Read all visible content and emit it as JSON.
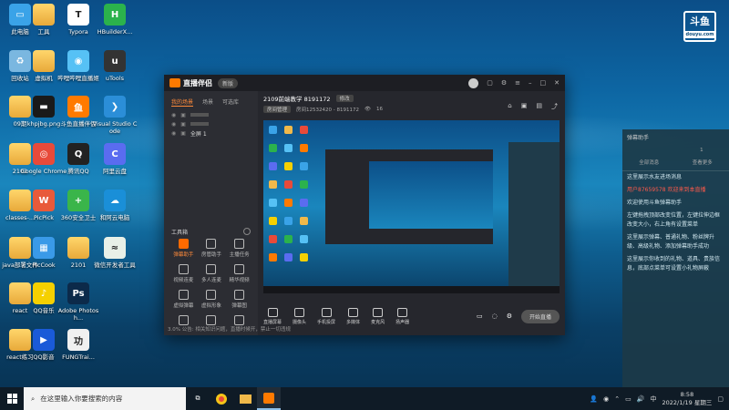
{
  "desktop_icons": [
    {
      "label": "此电脑",
      "color": "#3aa3e8",
      "glyph": "▭"
    },
    {
      "label": "工具",
      "color": "#f0b94a",
      "glyph": ""
    },
    {
      "label": "Typora",
      "color": "#ffffff",
      "glyph": "T"
    },
    {
      "label": "HBuilderX...",
      "color": "#2bb24c",
      "glyph": "H"
    },
    {
      "label": "回收站",
      "color": "#7ab7e0",
      "glyph": "♻"
    },
    {
      "label": "虚拟机",
      "color": "#f0b94a",
      "glyph": ""
    },
    {
      "label": "哔哩哔哩直播姬",
      "color": "#56c1f5",
      "glyph": "◉"
    },
    {
      "label": "uTools",
      "color": "#333333",
      "glyph": "u"
    },
    {
      "label": "09期",
      "color": "#f0b94a",
      "glyph": ""
    },
    {
      "label": "khpjbg.png",
      "color": "#1a1a1a",
      "glyph": "▬"
    },
    {
      "label": "斗鱼直播伴侣",
      "color": "#ff7a00",
      "glyph": "鱼"
    },
    {
      "label": "Visual Studio Code",
      "color": "#2b8ed8",
      "glyph": "❯"
    },
    {
      "label": "2101",
      "color": "#f0b94a",
      "glyph": ""
    },
    {
      "label": "Google Chrome",
      "color": "#e84a3a",
      "glyph": "◎"
    },
    {
      "label": "腾讯QQ",
      "color": "#222222",
      "glyph": "Q"
    },
    {
      "label": "阿里云盘",
      "color": "#5a6cf0",
      "glyph": "C"
    },
    {
      "label": "classes-...",
      "color": "#f0b94a",
      "glyph": ""
    },
    {
      "label": "PicPick",
      "color": "#e85a3a",
      "glyph": "W"
    },
    {
      "label": "360安全卫士",
      "color": "#3ab54a",
      "glyph": "+"
    },
    {
      "label": "和阿云电脑",
      "color": "#1a8fd8",
      "glyph": "☁"
    },
    {
      "label": "java部署文件",
      "color": "#f0b94a",
      "glyph": ""
    },
    {
      "label": "PicCook",
      "color": "#3a9ae8",
      "glyph": "▦"
    },
    {
      "label": "2101",
      "color": "#f0b94a",
      "glyph": ""
    },
    {
      "label": "微信开发者工具",
      "color": "#e8f0e8",
      "glyph": "≈"
    },
    {
      "label": "react",
      "color": "#f0b94a",
      "glyph": ""
    },
    {
      "label": "QQ音乐",
      "color": "#f5d000",
      "glyph": "♪"
    },
    {
      "label": "Adobe Photosh...",
      "color": "#0c2a4a",
      "glyph": "Ps"
    },
    {
      "label": "",
      "color": "#00000000",
      "glyph": ""
    },
    {
      "label": "react练习",
      "color": "#f0b94a",
      "glyph": ""
    },
    {
      "label": "QQ影音",
      "color": "#1a5ad8",
      "glyph": "▶"
    },
    {
      "label": "FUNGTrai...",
      "color": "#f0f0f0",
      "glyph": "功"
    }
  ],
  "window": {
    "app_name": "直播伴侣",
    "version_badge": "新版",
    "left_tabs": [
      "我的场景",
      "场景",
      "可选库"
    ],
    "active_tab_index": 0,
    "scene_rows": [
      {
        "label": "",
        "muted": true
      },
      {
        "label": "",
        "muted": true
      },
      {
        "label": "全屏 1",
        "muted": false
      }
    ],
    "tools_header": "工具箱",
    "tools": [
      {
        "label": "弹幕助手",
        "highlight": true
      },
      {
        "label": "房管助手",
        "highlight": false
      },
      {
        "label": "主播任务",
        "highlight": false
      },
      {
        "label": "视频连麦",
        "highlight": false
      },
      {
        "label": "多人连麦",
        "highlight": false
      },
      {
        "label": "精华视频",
        "highlight": false
      },
      {
        "label": "虚拟弹幕",
        "highlight": false
      },
      {
        "label": "虚拟形象",
        "highlight": false
      },
      {
        "label": "弹幕图",
        "highlight": false
      },
      {
        "label": "",
        "highlight": false
      },
      {
        "label": "",
        "highlight": false
      },
      {
        "label": "",
        "highlight": false
      }
    ],
    "room_title": "2109前端教学 8191172",
    "room_edit": "修改",
    "room_sub_btn": "房间管理",
    "room_id_text": "房间12532420 - 8191172",
    "room_count": "16",
    "controls": [
      {
        "label": "直播屏幕"
      },
      {
        "label": "摄像头"
      },
      {
        "label": "手机投屏"
      },
      {
        "label": "多媒体"
      },
      {
        "label": "麦克风"
      },
      {
        "label": "扬声器"
      }
    ],
    "start_button": "开始直播",
    "status_text": "3.0% 公告: 相关知识问题，直播时候开，禁止一切违规"
  },
  "side_panel": {
    "title": "弹幕助手",
    "tabs_row1": [
      "",
      "1"
    ],
    "tabs_row2": [
      "全部消息",
      "查看更多"
    ],
    "messages": [
      {
        "text": "这里展示水友进场消息",
        "red": false
      },
      {
        "text": "用户87659578 欢迎来到本直播",
        "red": true
      },
      {
        "text": "欢迎使用斗鱼弹幕助手",
        "red": false
      },
      {
        "text": "左键拖拽顶部改变位置，左键拉伸边框改变大小，右上角有设置菜单",
        "red": false
      },
      {
        "text": "这里展示弹幕、普通礼物、粉丝牌升级、高级礼物、添加弹幕助手成功",
        "red": false
      },
      {
        "text": "这里展示你收到的礼物、道具、贵族信息，底部点菜单可设置小礼物屏蔽",
        "red": false
      }
    ]
  },
  "taskbar": {
    "search_placeholder": "在这里输入你要搜索的内容",
    "time": "8:58",
    "date": "2022/1/19 星期三",
    "ime": "中"
  },
  "watermark": {
    "main": "斗鱼",
    "sub": "douyu.com"
  }
}
